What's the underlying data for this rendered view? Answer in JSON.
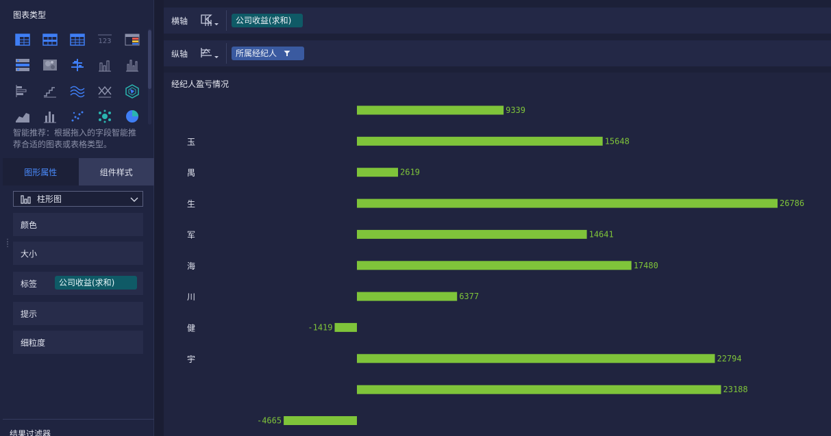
{
  "left_panel": {
    "section_title": "图表类型",
    "chart_types": [
      "cross-table-icon",
      "group-table-icon",
      "detail-table-icon",
      "kpi-number-icon",
      "colored-table-icon",
      "progress-table-icon",
      "heatmap-icon",
      "scatter-range-icon",
      "column-chart-icon",
      "grouped-column-chart-icon",
      "bar-chart-icon",
      "step-chart-icon",
      "multi-line-chart-icon",
      "crossing-lines-icon",
      "radar-chart-icon",
      "area-chart-icon",
      "stacked-column-icon",
      "scatter-chart-icon",
      "bubble-chart-icon",
      "pie-chart-icon"
    ],
    "hint": "智能推荐：根据拖入的字段智能推荐合适的图表或表格类型。",
    "tabs": {
      "properties": "图形属性",
      "style": "组件样式"
    },
    "chart_select": {
      "value": "柱形图",
      "icon": "column-chart-icon"
    },
    "properties": {
      "color": "颜色",
      "size": "大小",
      "label": "标签",
      "label_field": "公司收益(求和)",
      "tooltip": "提示",
      "granularity": "细粒度"
    },
    "filter_title": "结果过滤器"
  },
  "axes": {
    "x": {
      "label": "横轴",
      "field": "公司收益(求和)"
    },
    "y": {
      "label": "纵轴",
      "field": "所属经纪人"
    }
  },
  "chart": {
    "title": "经纪人盈亏情况"
  },
  "chart_data": {
    "type": "bar",
    "orientation": "horizontal",
    "title": "经纪人盈亏情况",
    "categories": [
      "",
      "玉",
      "禺",
      "生",
      "军",
      "海",
      "川",
      "健",
      "宇",
      "",
      ""
    ],
    "values": [
      9339,
      15648,
      2619,
      26786,
      14641,
      17480,
      6377,
      -1419,
      22794,
      23188,
      -4665
    ],
    "bar_color": "#7fc43a",
    "label_color": "#7fc43a",
    "legend": "none",
    "grid": false
  }
}
